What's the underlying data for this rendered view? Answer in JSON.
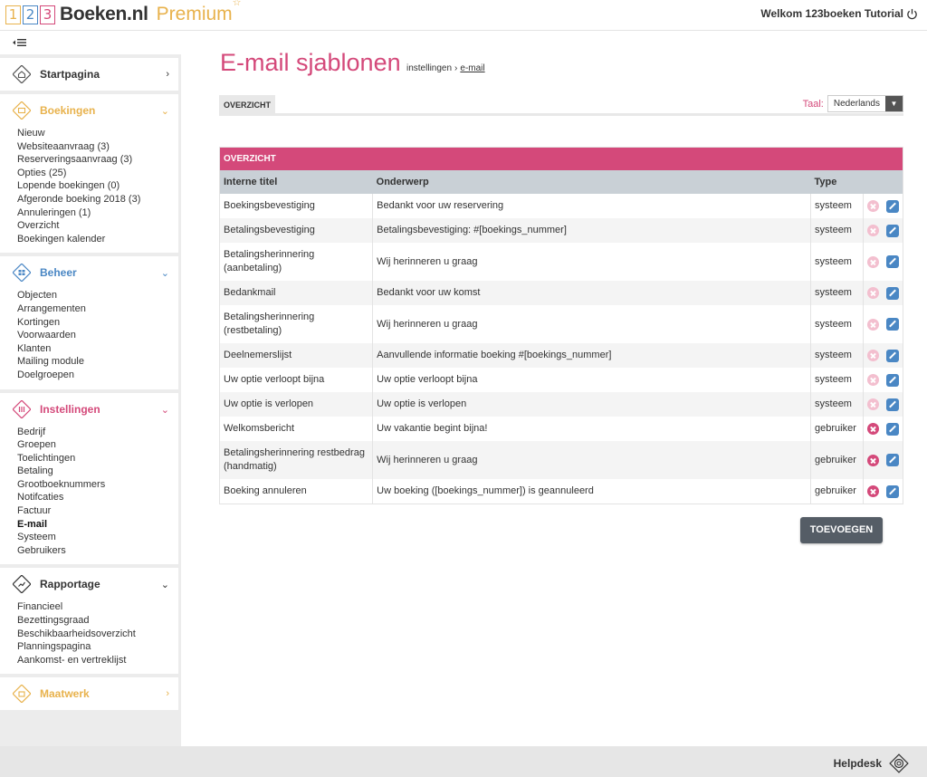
{
  "header": {
    "logo_nums": [
      "1",
      "2",
      "3"
    ],
    "logo_name": "Boeken.nl",
    "logo_premium": "Premium",
    "logo_star": "☆",
    "welcome": "Welkom 123boeken Tutorial"
  },
  "sidebar": {
    "collapse_glyph": "⇤≡",
    "startpagina": "Startpagina",
    "boekingen": {
      "title": "Boekingen",
      "items": [
        "Nieuw",
        "Websiteaanvraag (3)",
        "Reserveringsaanvraag (3)",
        "Opties (25)",
        "Lopende boekingen (0)",
        "Afgeronde boeking 2018 (3)",
        "Annuleringen (1)",
        "Overzicht",
        "Boekingen kalender"
      ]
    },
    "beheer": {
      "title": "Beheer",
      "items": [
        "Objecten",
        "Arrangementen",
        "Kortingen",
        "Voorwaarden",
        "Klanten",
        "Mailing module",
        "Doelgroepen"
      ]
    },
    "instellingen": {
      "title": "Instellingen",
      "items": [
        "Bedrijf",
        "Groepen",
        "Toelichtingen",
        "Betaling",
        "Grootboeknummers",
        "Notifcaties",
        "Factuur",
        "E-mail",
        "Systeem",
        "Gebruikers"
      ]
    },
    "rapportage": {
      "title": "Rapportage",
      "items": [
        "Financieel",
        "Bezettingsgraad",
        "Beschikbaarheidsoverzicht",
        "Planningspagina",
        "Aankomst- en vertreklijst"
      ]
    },
    "maatwerk": "Maatwerk"
  },
  "main": {
    "title": "E-mail sjablonen",
    "breadcrumb": {
      "parent": "instellingen",
      "sep": "›",
      "current": "e-mail"
    },
    "tab": "OVERZICHT",
    "lang_label": "Taal:",
    "lang_value": "Nederlands",
    "panel_title": "OVERZICHT",
    "columns": [
      "Interne titel",
      "Onderwerp",
      "Type"
    ],
    "rows": [
      [
        "Boekingsbevestiging",
        "Bedankt voor uw reservering",
        "systeem"
      ],
      [
        "Betalingsbevestiging",
        "Betalingsbevestiging: #[boekings_nummer]",
        "systeem"
      ],
      [
        "Betalingsherinnering (aanbetaling)",
        "Wij herinneren u graag",
        "systeem"
      ],
      [
        "Bedankmail",
        "Bedankt voor uw komst",
        "systeem"
      ],
      [
        "Betalingsherinnering (restbetaling)",
        "Wij herinneren u graag",
        "systeem"
      ],
      [
        "Deelnemerslijst",
        "Aanvullende informatie boeking #[boekings_nummer]",
        "systeem"
      ],
      [
        "Uw optie verloopt bijna",
        "Uw optie verloopt bijna",
        "systeem"
      ],
      [
        "Uw optie is verlopen",
        "Uw optie is verlopen",
        "systeem"
      ],
      [
        "Welkomsbericht",
        "Uw vakantie begint bijna!",
        "gebruiker"
      ],
      [
        "Betalingsherinnering restbedrag (handmatig)",
        "Wij herinneren u graag",
        "gebruiker"
      ],
      [
        "Boeking annuleren",
        "Uw boeking ([boekings_nummer]) is geannuleerd",
        "gebruiker"
      ]
    ],
    "add_button": "TOEVOEGEN"
  },
  "footer": {
    "helpdesk": "Helpdesk"
  },
  "colors": {
    "pink": "#d4497a",
    "orange": "#e8b24c",
    "blue": "#4a87c4",
    "header_gray": "#c9d0d6"
  }
}
